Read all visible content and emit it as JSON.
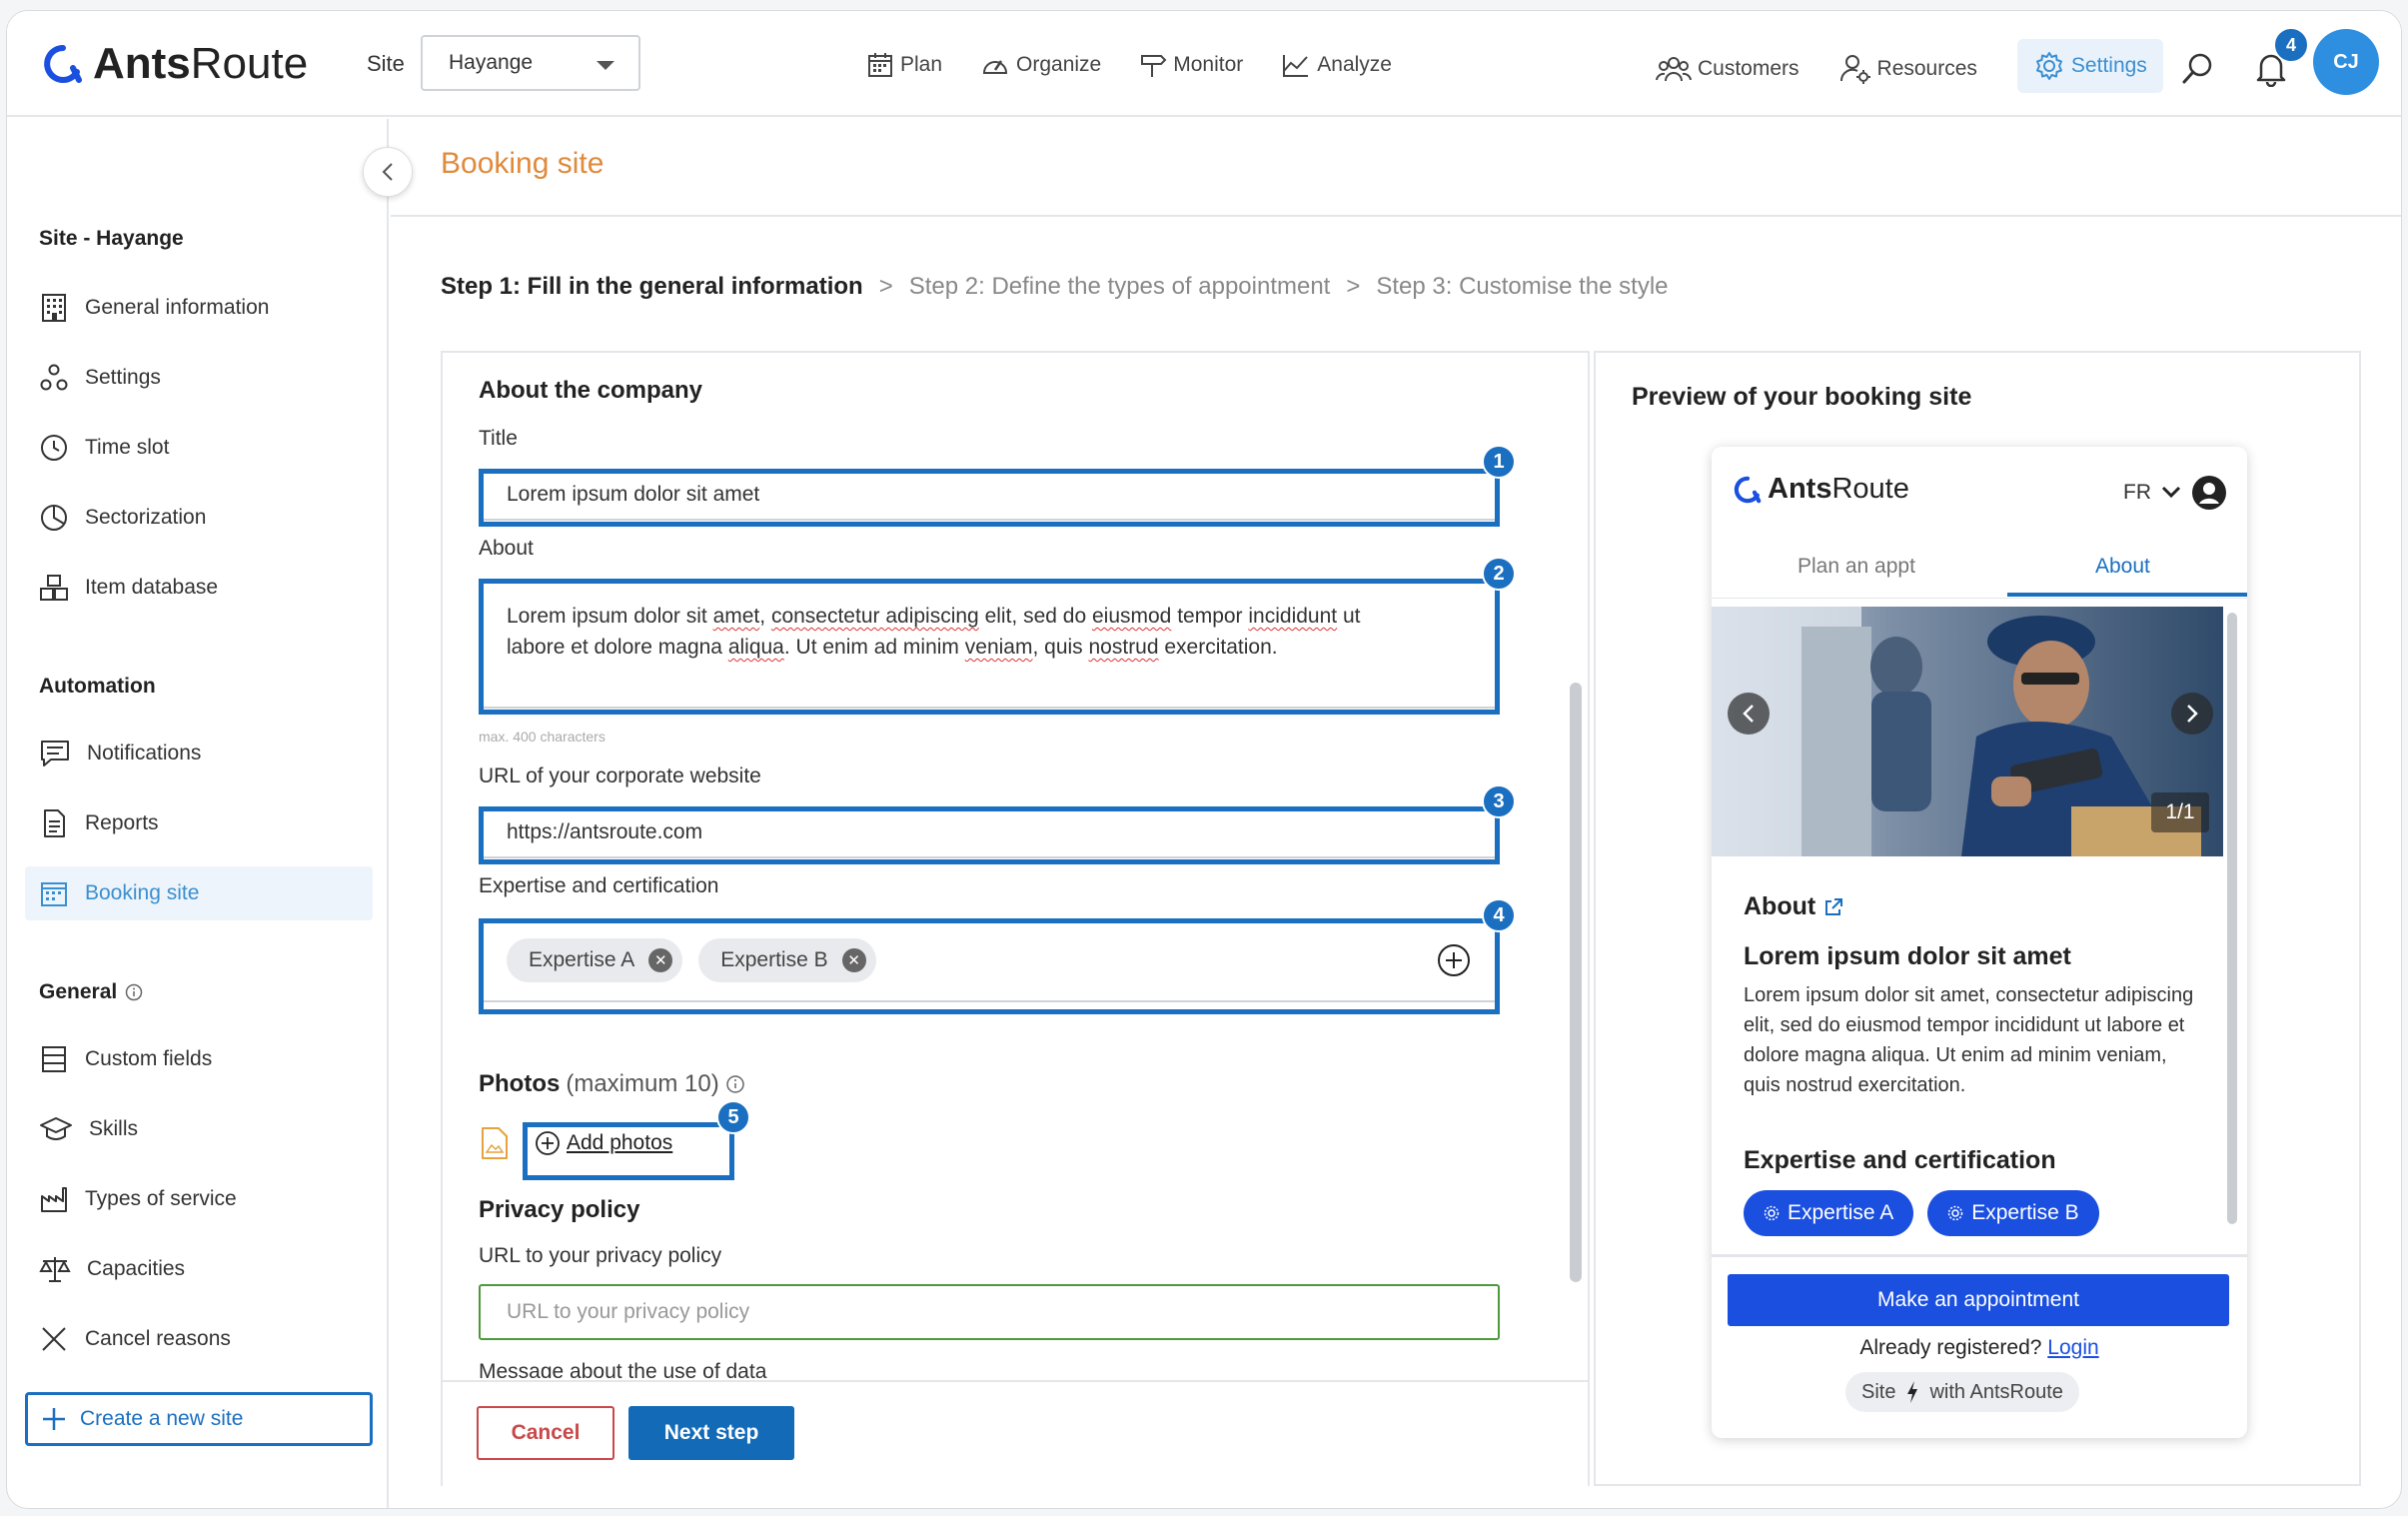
{
  "header": {
    "logo_bold": "Ants",
    "logo_light": "Route",
    "site_label": "Site",
    "site_value": "Hayange",
    "nav": [
      {
        "label": "Plan",
        "icon": "calendar-icon"
      },
      {
        "label": "Organize",
        "icon": "gauge-icon"
      },
      {
        "label": "Monitor",
        "icon": "signpost-icon"
      },
      {
        "label": "Analyze",
        "icon": "chart-icon"
      }
    ],
    "right_nav": [
      {
        "label": "Customers",
        "icon": "customers-icon"
      },
      {
        "label": "Resources",
        "icon": "resources-icon"
      },
      {
        "label": "Settings",
        "icon": "gear-icon"
      }
    ],
    "notification_count": "4",
    "avatar_initials": "CJ"
  },
  "sidebar": {
    "site_heading": "Site - Hayange",
    "site_items": [
      "General information",
      "Settings",
      "Time slot",
      "Sectorization",
      "Item database"
    ],
    "automation_heading": "Automation",
    "automation_items": [
      "Notifications",
      "Reports",
      "Booking site"
    ],
    "general_heading": "General",
    "general_items": [
      "Custom fields",
      "Skills",
      "Types of service",
      "Capacities",
      "Cancel reasons"
    ],
    "create_site": "Create a new site"
  },
  "page": {
    "title": "Booking site",
    "step1": "Step 1: Fill in the general information",
    "step2": "Step 2: Define the types of appointment",
    "step3": "Step 3: Customise the style",
    "step_sep": ">"
  },
  "form": {
    "section_company": "About the company",
    "title_label": "Title",
    "title_value": "Lorem ipsum dolor sit amet",
    "about_label": "About",
    "about_line1_a": "Lorem ipsum dolor sit ",
    "about_w1": "amet",
    "about_line1_b": ", ",
    "about_w2": "consectetur adipiscing",
    "about_line1_c": " elit, sed do ",
    "about_w3": "eiusmod",
    "about_line1_d": " tempor ",
    "about_w4": "incididunt",
    "about_line1_e": " ut",
    "about_line2_a": "labore et dolore magna ",
    "about_w5": "aliqua",
    "about_line2_b": ". Ut enim ad minim ",
    "about_w6": "veniam",
    "about_line2_c": ", quis ",
    "about_w7": "nostrud",
    "about_line2_d": " exercitation.",
    "about_hint": "max. 400 characters",
    "url_label": "URL of your corporate website",
    "url_value": "https://antsroute.com",
    "expertise_label": "Expertise and certification",
    "chips": [
      "Expertise A",
      "Expertise B"
    ],
    "photos_label": "Photos",
    "photos_hint": "(maximum 10)",
    "add_photos": "Add photos",
    "privacy_section": "Privacy policy",
    "privacy_label": "URL to your privacy policy",
    "privacy_placeholder": "URL to your privacy policy",
    "data_message_label": "Message about the use of data",
    "cancel": "Cancel",
    "next": "Next step",
    "callouts": [
      "1",
      "2",
      "3",
      "4",
      "5"
    ]
  },
  "preview": {
    "title": "Preview of your booking site",
    "logo_bold": "Ants",
    "logo_light": "Route",
    "lang": "FR",
    "tab_plan": "Plan an appt",
    "tab_about": "About",
    "counter": "1/1",
    "about_heading": "About",
    "company_title": "Lorem ipsum dolor sit amet",
    "company_text": "Lorem ipsum dolor sit amet, consectetur adipiscing elit, sed do eiusmod tempor incididunt ut labore et dolore magna aliqua. Ut enim ad minim veniam, quis nostrud exercitation.",
    "expertise_heading": "Expertise and certification",
    "chips": [
      "Expertise A",
      "Expertise B"
    ],
    "make_appointment": "Make an appointment",
    "already_registered": "Already registered?",
    "login": "Login",
    "badge_left": "Site",
    "badge_right": "with AntsRoute"
  },
  "colors": {
    "accent": "#1a6fc0",
    "brand_orange": "#e08a3c",
    "preview_blue": "#1a4fe0",
    "danger": "#c9484a"
  }
}
